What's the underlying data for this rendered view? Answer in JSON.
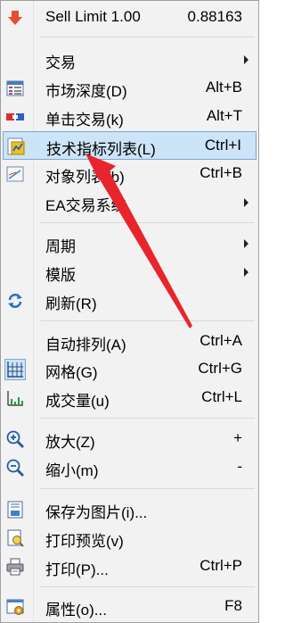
{
  "menu": {
    "sell_limit": {
      "label": "Sell Limit 1.00",
      "shortcut": "0.88163",
      "icon": "sell-down-arrow-icon"
    },
    "trading": {
      "label": "交易"
    },
    "market_depth": {
      "label": "市场深度(D)",
      "shortcut": "Alt+B",
      "icon": "market-depth-icon"
    },
    "one_click": {
      "label": "单击交易(k)",
      "shortcut": "Alt+T",
      "icon": "one-click-trading-icon"
    },
    "indicators_list": {
      "label": "技术指标列表(L)",
      "shortcut": "Ctrl+I",
      "icon": "indicators-icon"
    },
    "objects_list": {
      "label": "对象列表(b)",
      "shortcut": "Ctrl+B",
      "icon": "objects-list-icon"
    },
    "ea_trading": {
      "label": "EA交易系统"
    },
    "period": {
      "label": "周期"
    },
    "template": {
      "label": "模版"
    },
    "refresh": {
      "label": "刷新(R)",
      "icon": "refresh-icon"
    },
    "auto_arrange": {
      "label": "自动排列(A)",
      "shortcut": "Ctrl+A"
    },
    "grid": {
      "label": "网格(G)",
      "shortcut": "Ctrl+G",
      "icon": "grid-icon"
    },
    "volumes": {
      "label": "成交量(u)",
      "shortcut": "Ctrl+L",
      "icon": "volumes-icon"
    },
    "zoom_in": {
      "label": "放大(Z)",
      "shortcut": "+",
      "icon": "zoom-in-icon"
    },
    "zoom_out": {
      "label": "缩小(m)",
      "shortcut": "-",
      "icon": "zoom-out-icon"
    },
    "save_picture": {
      "label": "保存为图片(i)...",
      "icon": "save-picture-icon"
    },
    "print_preview": {
      "label": "打印预览(v)",
      "icon": "print-preview-icon"
    },
    "print": {
      "label": "打印(P)...",
      "shortcut": "Ctrl+P",
      "icon": "printer-icon"
    },
    "properties": {
      "label": "属性(o)...",
      "shortcut": "F8",
      "icon": "properties-icon"
    }
  },
  "colors": {
    "highlight_bg": "#cce4f7",
    "highlight_border": "#7aa8d4",
    "annotation_arrow": "#e8242c"
  }
}
